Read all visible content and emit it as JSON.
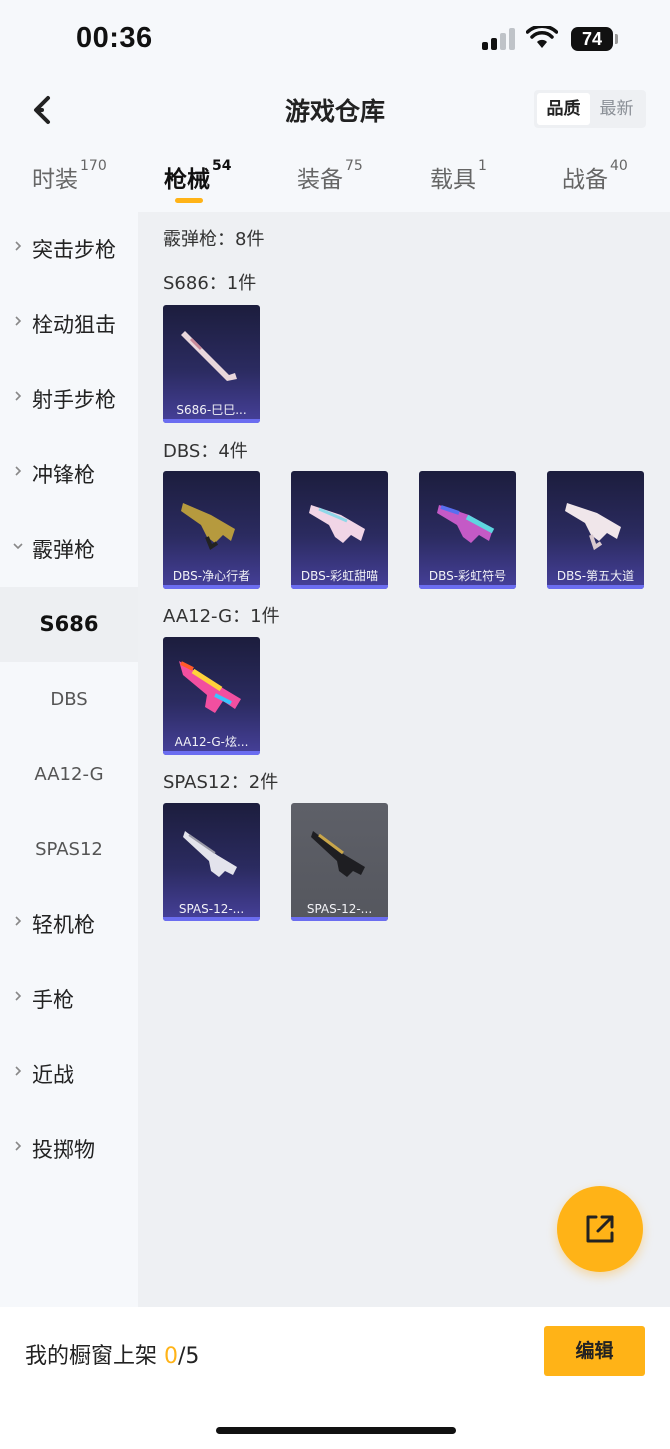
{
  "status_bar": {
    "time": "00:36",
    "battery": "74"
  },
  "nav": {
    "title": "游戏仓库",
    "sort_quality": "品质",
    "sort_latest": "最新"
  },
  "tabs": [
    {
      "label": "时装",
      "count": "170"
    },
    {
      "label": "枪械",
      "count": "54"
    },
    {
      "label": "装备",
      "count": "75"
    },
    {
      "label": "载具",
      "count": "1"
    },
    {
      "label": "战备",
      "count": "40"
    }
  ],
  "sidebar": {
    "categories": [
      "突击步枪",
      "栓动狙击",
      "射手步枪",
      "冲锋枪",
      "霰弹枪",
      "轻机枪",
      "手枪",
      "近战",
      "投掷物"
    ],
    "sub_items": [
      "S686",
      "DBS",
      "AA12-G",
      "SPAS12"
    ]
  },
  "content": {
    "category_total": "霰弹枪：8件",
    "groups": [
      {
        "name": "S686：1件",
        "items": [
          "S686-巳巳..."
        ]
      },
      {
        "name": "DBS：4件",
        "items": [
          "DBS-净心行者",
          "DBS-彩虹甜喵",
          "DBS-彩虹符号",
          "DBS-第五大道"
        ]
      },
      {
        "name": "AA12-G：1件",
        "items": [
          "AA12-G-炫..."
        ]
      },
      {
        "name": "SPAS12：2件",
        "items": [
          "SPAS-12-...",
          "SPAS-12-..."
        ]
      }
    ]
  },
  "bottom": {
    "showcase_label": "我的橱窗上架 ",
    "showcase_current": "0",
    "showcase_total": "/5",
    "edit": "编辑"
  },
  "colors": {
    "accent": "#ffb317",
    "card_bg": "#2b2b60",
    "card_bar": "#6b6df0"
  }
}
